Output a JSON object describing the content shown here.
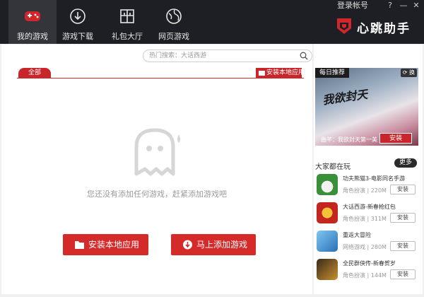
{
  "titlebar": {
    "tabs": [
      {
        "label": "我的游戏",
        "icon": "gamepad-icon",
        "active": true
      },
      {
        "label": "游戏下载",
        "icon": "download-icon",
        "active": false
      },
      {
        "label": "礼包大厅",
        "icon": "gift-icon",
        "active": false
      },
      {
        "label": "网页游戏",
        "icon": "web-globe-icon",
        "active": false
      }
    ],
    "login": "登录帐号",
    "help": "?",
    "minimize": "—",
    "close": "✕",
    "brand": "心跳助手"
  },
  "main": {
    "search_placeholder": "热门搜索：大话西游",
    "all_tab": "全部",
    "install_local_small": "安装本地应用",
    "empty_message": "您还没有添加任何游戏，赶紧添加游戏吧",
    "install_local_button": "安装本地应用",
    "add_game_button": "马上添加游戏"
  },
  "sidebar": {
    "daily_tag": "每日推荐",
    "swap": "换",
    "ad_title": "我欲封天",
    "ad_subtitle": "曲芊：我欲封天第一美",
    "ad_install": "安装",
    "section_title": "大家都在玩",
    "more": "更多",
    "games": [
      {
        "name": "功夫熊猫3-电影同名手游",
        "genre": "角色扮演",
        "size": "220M",
        "action": "安装"
      },
      {
        "name": "大话西游-新春抢红包",
        "genre": "角色扮演",
        "size": "311M",
        "action": "安装"
      },
      {
        "name": "重返大冒险",
        "genre": "网络游戏",
        "size": "280M",
        "action": "安装"
      },
      {
        "name": "全民群侠传-新春贺岁",
        "genre": "角色扮演",
        "size": "144M",
        "action": "安装"
      }
    ]
  },
  "colors": {
    "accent_red": "#c9262b",
    "titlebar_bg": "#1e1f24"
  }
}
